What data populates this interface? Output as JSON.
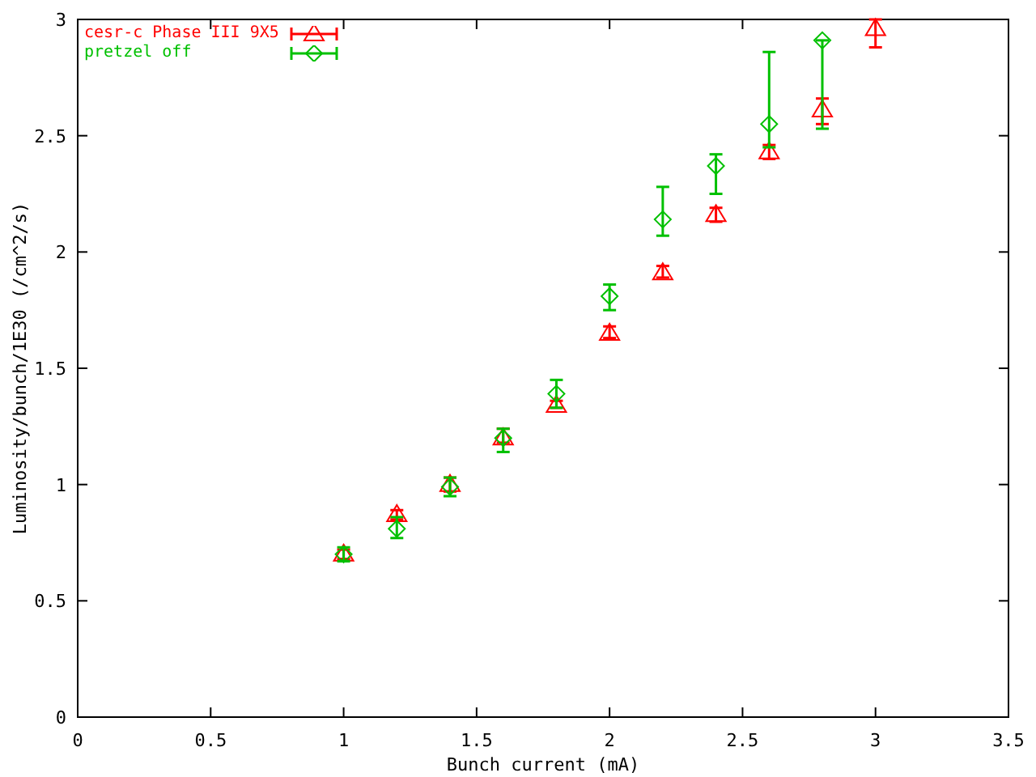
{
  "chart_data": {
    "type": "scatter",
    "xlabel": "Bunch current (mA)",
    "ylabel": "Luminosity/bunch/1E30 (/cm^2/s)",
    "xlim": [
      0,
      3.5
    ],
    "ylim": [
      0,
      3
    ],
    "xticks": [
      0,
      0.5,
      1,
      1.5,
      2,
      2.5,
      3,
      3.5
    ],
    "yticks": [
      0,
      0.5,
      1,
      1.5,
      2,
      2.5,
      3
    ],
    "series": [
      {
        "name": "cesr-c Phase III 9X5",
        "color": "#ff0000",
        "marker": "triangle",
        "x": [
          1,
          1.2,
          1.4,
          1.6,
          1.8,
          2,
          2.2,
          2.4,
          2.6,
          2.8,
          3
        ],
        "values": [
          0.7,
          0.87,
          1,
          1.2,
          1.34,
          1.65,
          1.91,
          2.16,
          2.43,
          2.61,
          2.96
        ],
        "errors": [
          [
            0.68,
            0.72
          ],
          [
            0.85,
            0.89
          ],
          [
            0.97,
            1.03
          ],
          [
            1.18,
            1.24
          ],
          [
            1.33,
            1.36
          ],
          [
            1.63,
            1.68
          ],
          [
            1.89,
            1.94
          ],
          [
            2.13,
            2.19
          ],
          [
            2.4,
            2.46
          ],
          [
            2.55,
            2.66
          ],
          [
            2.88,
            3
          ]
        ]
      },
      {
        "name": "pretzel off",
        "color": "#00c000",
        "marker": "diamond",
        "x": [
          1,
          1.2,
          1.4,
          1.6,
          1.8,
          2,
          2.2,
          2.4,
          2.6,
          2.8
        ],
        "values": [
          0.7,
          0.81,
          0.99,
          1.2,
          1.39,
          1.81,
          2.14,
          2.37,
          2.55,
          2.91
        ],
        "errors": [
          [
            0.67,
            0.73
          ],
          [
            0.77,
            0.86
          ],
          [
            0.95,
            1.03
          ],
          [
            1.14,
            1.24
          ],
          [
            1.33,
            1.45
          ],
          [
            1.75,
            1.86
          ],
          [
            2.07,
            2.28
          ],
          [
            2.25,
            2.42
          ],
          [
            2.45,
            2.86
          ],
          [
            2.53,
            2.91
          ]
        ]
      }
    ]
  }
}
